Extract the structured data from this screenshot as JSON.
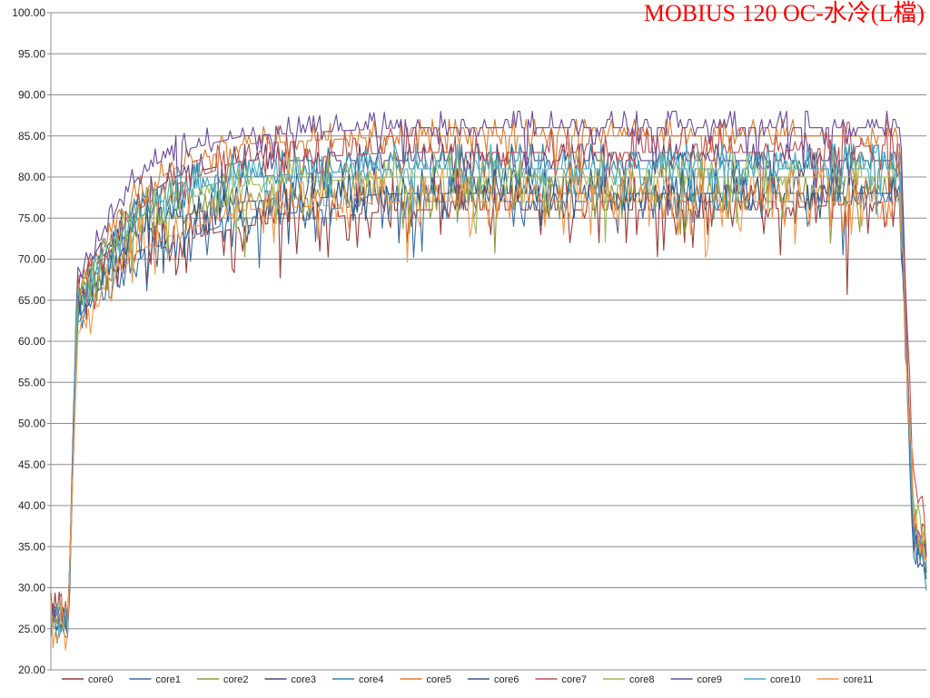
{
  "chart_data": {
    "type": "line",
    "title": "MOBIUS 120 OC-水冷(L檔)",
    "xlabel": "",
    "ylabel": "",
    "ylim": [
      20,
      100
    ],
    "y_ticks": [
      "20.00",
      "25.00",
      "30.00",
      "35.00",
      "40.00",
      "45.00",
      "50.00",
      "55.00",
      "60.00",
      "65.00",
      "70.00",
      "75.00",
      "80.00",
      "85.00",
      "90.00",
      "95.00",
      "100.00"
    ],
    "x_range": [
      0,
      100
    ],
    "grid": "horizontal",
    "legend_position": "bottom",
    "series": [
      {
        "name": "core0",
        "color": "#9e3c3a",
        "key": [
          [
            0,
            28
          ],
          [
            2,
            27
          ],
          [
            3,
            64
          ],
          [
            6,
            68
          ],
          [
            10,
            71
          ],
          [
            14,
            72
          ],
          [
            22,
            74
          ],
          [
            40,
            76
          ],
          [
            60,
            76
          ],
          [
            80,
            76
          ],
          [
            97,
            77
          ],
          [
            98.5,
            37
          ],
          [
            100,
            34
          ]
        ],
        "amp": 4
      },
      {
        "name": "core1",
        "color": "#3a6ea8",
        "key": [
          [
            0,
            26
          ],
          [
            2,
            25
          ],
          [
            3,
            63
          ],
          [
            6,
            67
          ],
          [
            10,
            70
          ],
          [
            14,
            72
          ],
          [
            22,
            75
          ],
          [
            40,
            77
          ],
          [
            60,
            77
          ],
          [
            80,
            77
          ],
          [
            97,
            77
          ],
          [
            98.5,
            35
          ],
          [
            100,
            32
          ]
        ],
        "amp": 3
      },
      {
        "name": "core2",
        "color": "#8a9a3c",
        "key": [
          [
            0,
            27
          ],
          [
            2,
            26
          ],
          [
            3,
            64
          ],
          [
            6,
            68
          ],
          [
            10,
            73
          ],
          [
            14,
            75
          ],
          [
            22,
            77
          ],
          [
            40,
            78
          ],
          [
            60,
            78
          ],
          [
            80,
            78
          ],
          [
            97,
            78
          ],
          [
            98.5,
            38
          ],
          [
            100,
            34
          ]
        ],
        "amp": 3
      },
      {
        "name": "core3",
        "color": "#5b3f7e",
        "key": [
          [
            0,
            27
          ],
          [
            2,
            26
          ],
          [
            3,
            66
          ],
          [
            6,
            71
          ],
          [
            10,
            77
          ],
          [
            14,
            80
          ],
          [
            22,
            82
          ],
          [
            40,
            82
          ],
          [
            60,
            82
          ],
          [
            80,
            82
          ],
          [
            97,
            82
          ],
          [
            98.5,
            36
          ],
          [
            100,
            33
          ]
        ],
        "amp": 2
      },
      {
        "name": "core4",
        "color": "#2e8aa6",
        "key": [
          [
            0,
            26
          ],
          [
            2,
            25
          ],
          [
            3,
            64
          ],
          [
            6,
            69
          ],
          [
            10,
            75
          ],
          [
            14,
            78
          ],
          [
            22,
            80
          ],
          [
            40,
            81
          ],
          [
            60,
            81
          ],
          [
            80,
            81
          ],
          [
            97,
            81
          ],
          [
            98.5,
            36
          ],
          [
            100,
            32
          ]
        ],
        "amp": 3
      },
      {
        "name": "core5",
        "color": "#e07b2a",
        "key": [
          [
            0,
            27
          ],
          [
            2,
            26
          ],
          [
            3,
            66
          ],
          [
            6,
            72
          ],
          [
            10,
            78
          ],
          [
            14,
            81
          ],
          [
            22,
            84
          ],
          [
            40,
            85
          ],
          [
            60,
            85
          ],
          [
            80,
            85
          ],
          [
            97,
            85
          ],
          [
            98.5,
            38
          ],
          [
            100,
            34
          ]
        ],
        "amp": 2
      },
      {
        "name": "core6",
        "color": "#2e5c8a",
        "key": [
          [
            0,
            26
          ],
          [
            2,
            25
          ],
          [
            3,
            64
          ],
          [
            6,
            69
          ],
          [
            10,
            73
          ],
          [
            14,
            75
          ],
          [
            22,
            77
          ],
          [
            40,
            78
          ],
          [
            60,
            78
          ],
          [
            80,
            78
          ],
          [
            97,
            78
          ],
          [
            98.5,
            35
          ],
          [
            100,
            32
          ]
        ],
        "amp": 3
      },
      {
        "name": "core7",
        "color": "#c0504d",
        "key": [
          [
            0,
            28
          ],
          [
            2,
            27
          ],
          [
            3,
            66
          ],
          [
            6,
            71
          ],
          [
            10,
            76
          ],
          [
            14,
            79
          ],
          [
            22,
            82
          ],
          [
            40,
            83
          ],
          [
            60,
            83
          ],
          [
            80,
            83
          ],
          [
            97,
            84
          ],
          [
            98.5,
            45
          ],
          [
            100,
            36
          ]
        ],
        "amp": 3
      },
      {
        "name": "core8",
        "color": "#9bbb59",
        "key": [
          [
            0,
            27
          ],
          [
            2,
            26
          ],
          [
            3,
            65
          ],
          [
            6,
            70
          ],
          [
            10,
            75
          ],
          [
            14,
            77
          ],
          [
            22,
            79
          ],
          [
            40,
            80
          ],
          [
            60,
            80
          ],
          [
            80,
            80
          ],
          [
            97,
            80
          ],
          [
            98.5,
            40
          ],
          [
            100,
            35
          ]
        ],
        "amp": 3
      },
      {
        "name": "core9",
        "color": "#6a4a9c",
        "key": [
          [
            0,
            27
          ],
          [
            2,
            26
          ],
          [
            3,
            68
          ],
          [
            6,
            74
          ],
          [
            10,
            80
          ],
          [
            14,
            83
          ],
          [
            22,
            85
          ],
          [
            40,
            86
          ],
          [
            60,
            86
          ],
          [
            80,
            86
          ],
          [
            97,
            86
          ],
          [
            98.5,
            37
          ],
          [
            100,
            34
          ]
        ],
        "amp": 2
      },
      {
        "name": "core10",
        "color": "#4bacc6",
        "key": [
          [
            0,
            26
          ],
          [
            2,
            25
          ],
          [
            3,
            65
          ],
          [
            6,
            70
          ],
          [
            10,
            75
          ],
          [
            14,
            78
          ],
          [
            22,
            80
          ],
          [
            40,
            81
          ],
          [
            60,
            81
          ],
          [
            80,
            81
          ],
          [
            97,
            81
          ],
          [
            98.5,
            36
          ],
          [
            100,
            32
          ]
        ],
        "amp": 3
      },
      {
        "name": "core11",
        "color": "#f79646",
        "key": [
          [
            0,
            26
          ],
          [
            2,
            25
          ],
          [
            3,
            60
          ],
          [
            6,
            66
          ],
          [
            10,
            71
          ],
          [
            14,
            73
          ],
          [
            22,
            76
          ],
          [
            40,
            77
          ],
          [
            60,
            77
          ],
          [
            80,
            77
          ],
          [
            97,
            77
          ],
          [
            98.5,
            40
          ],
          [
            100,
            34
          ]
        ],
        "amp": 4
      }
    ]
  }
}
